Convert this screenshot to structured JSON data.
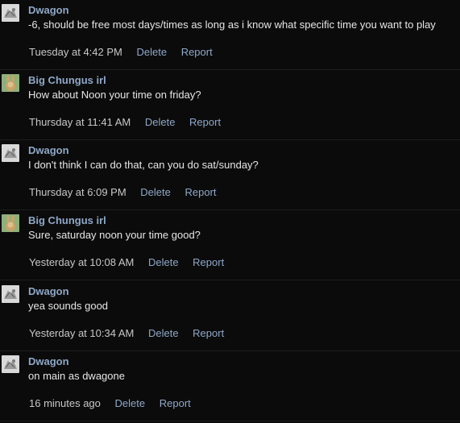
{
  "messages": [
    {
      "author": "Dwagon",
      "avatar": "grey-sketch-avatar",
      "text": "-6, should be free most days/times as long as i know what specific time you want to play",
      "time": "Tuesday at 4:42 PM",
      "delete_label": "Delete",
      "report_label": "Report"
    },
    {
      "author": "Big Chungus irl",
      "avatar": "rabbit-avatar",
      "text": "How about Noon your time on friday?",
      "time": "Thursday at 11:41 AM",
      "delete_label": "Delete",
      "report_label": "Report"
    },
    {
      "author": "Dwagon",
      "avatar": "grey-sketch-avatar",
      "text": "I don't think I can do that, can you do sat/sunday?",
      "time": "Thursday at 6:09 PM",
      "delete_label": "Delete",
      "report_label": "Report"
    },
    {
      "author": "Big Chungus irl",
      "avatar": "rabbit-avatar",
      "text": "Sure, saturday noon your time good?",
      "time": "Yesterday at 10:08 AM",
      "delete_label": "Delete",
      "report_label": "Report"
    },
    {
      "author": "Dwagon",
      "avatar": "grey-sketch-avatar",
      "text": "yea sounds good",
      "time": "Yesterday at 10:34 AM",
      "delete_label": "Delete",
      "report_label": "Report"
    },
    {
      "author": "Dwagon",
      "avatar": "grey-sketch-avatar",
      "text": "on main as dwagone",
      "time": "16 minutes ago",
      "delete_label": "Delete",
      "report_label": "Report"
    }
  ],
  "colors": {
    "background": "#0b0b0b",
    "link": "#8fa8c8",
    "text": "#e6e6e6",
    "timestamp": "#c8c8c8"
  }
}
